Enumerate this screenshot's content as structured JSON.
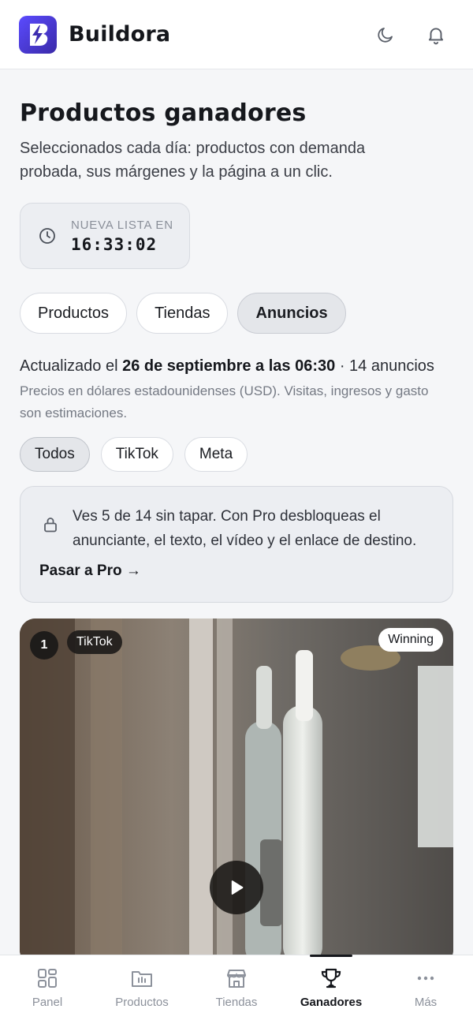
{
  "app": {
    "name": "Buildora"
  },
  "header": {
    "theme_toggle_icon": "moon-icon",
    "notifications_icon": "bell-icon"
  },
  "page": {
    "title": "Productos ganadores",
    "subtitle": "Seleccionados cada día: productos con demanda probada, sus márgenes y la página a un clic."
  },
  "timer": {
    "label": "NUEVA LISTA EN",
    "value": "16:33:02",
    "icon": "clock-icon"
  },
  "tabs": [
    {
      "label": "Productos",
      "active": false
    },
    {
      "label": "Tiendas",
      "active": false
    },
    {
      "label": "Anuncios",
      "active": true
    }
  ],
  "update": {
    "prefix": "Actualizado el",
    "date": "26 de septiembre a las 06:30",
    "count": "· 14 anuncios",
    "note": "Precios en dólares estadounidenses (USD). Visitas, ingresos y gasto son estimaciones."
  },
  "filters": [
    {
      "label": "Todos",
      "active": true
    },
    {
      "label": "TikTok",
      "active": false
    },
    {
      "label": "Meta",
      "active": false
    }
  ],
  "pro_banner": {
    "icon": "lock-icon",
    "text": "Ves 5 de 14 sin tapar. Con Pro desbloqueas el anunciante, el texto, el vídeo y el enlace de destino.",
    "link": "Pasar a Pro →"
  },
  "ad": {
    "rank": "1",
    "platform": "TikTok",
    "status": "Winning",
    "play_icon": "play-icon"
  },
  "bottom_nav": [
    {
      "label": "Panel",
      "icon": "grid-icon",
      "active": false
    },
    {
      "label": "Productos",
      "icon": "box-icon",
      "active": false
    },
    {
      "label": "Tiendas",
      "icon": "store-icon",
      "active": false
    },
    {
      "label": "Ganadores",
      "icon": "trophy-icon",
      "active": true
    },
    {
      "label": "Más",
      "icon": "more-icon",
      "active": false
    }
  ]
}
